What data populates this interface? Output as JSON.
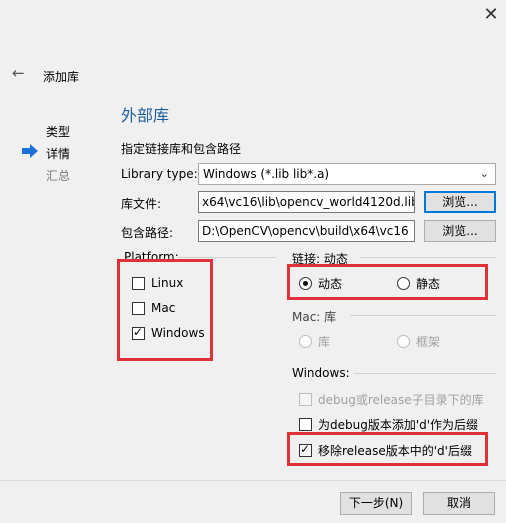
{
  "wizard": {
    "title": "添加库",
    "steps": [
      "类型",
      "详情",
      "汇总"
    ]
  },
  "page": {
    "heading": "外部库",
    "subtitle": "指定链接库和包含路径",
    "library_type_label": "Library type:",
    "library_type_value": "Windows (*.lib lib*.a)",
    "lib_file_label": "库文件:",
    "lib_file_value": "x64\\vc16\\lib\\opencv_world4120d.lib",
    "include_label": "包含路径:",
    "include_value": "D:\\OpenCV\\opencv\\build\\x64\\vc16",
    "browse_label": "浏览..."
  },
  "platform": {
    "label": "Platform:",
    "options": [
      {
        "label": "Linux",
        "checked": false
      },
      {
        "label": "Mac",
        "checked": false
      },
      {
        "label": "Windows",
        "checked": true
      }
    ]
  },
  "linkage": {
    "label": "链接:  动态",
    "dynamic": "动态",
    "static": "静态",
    "selected": "dynamic"
  },
  "mac": {
    "label": "Mac:  库",
    "lib": "库",
    "framework": "框架"
  },
  "windows": {
    "label": "Windows:",
    "options": [
      {
        "label": "debug或release子目录下的库",
        "checked": false,
        "disabled": true
      },
      {
        "label": "为debug版本添加'd'作为后缀",
        "checked": false,
        "disabled": false
      },
      {
        "label": "移除release版本中的'd'后缀",
        "checked": true,
        "disabled": false
      }
    ]
  },
  "footer": {
    "next": "下一步(N)",
    "cancel": "取消"
  },
  "colors": {
    "highlight": "#e0303a",
    "heading": "#1f5d9c",
    "focus": "#0078d7"
  }
}
